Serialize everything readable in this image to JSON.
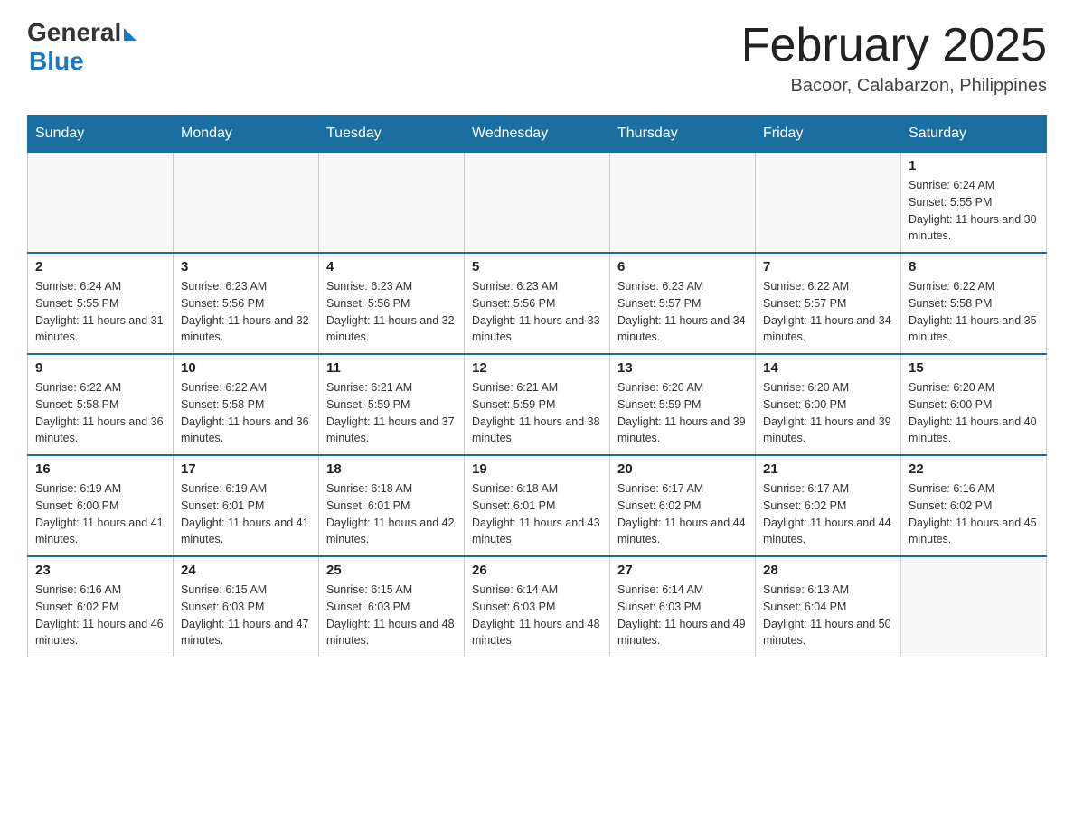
{
  "header": {
    "logo_general": "General",
    "logo_blue": "Blue",
    "month_title": "February 2025",
    "location": "Bacoor, Calabarzon, Philippines"
  },
  "days_of_week": [
    "Sunday",
    "Monday",
    "Tuesday",
    "Wednesday",
    "Thursday",
    "Friday",
    "Saturday"
  ],
  "weeks": [
    [
      {
        "day": "",
        "sunrise": "",
        "sunset": "",
        "daylight": ""
      },
      {
        "day": "",
        "sunrise": "",
        "sunset": "",
        "daylight": ""
      },
      {
        "day": "",
        "sunrise": "",
        "sunset": "",
        "daylight": ""
      },
      {
        "day": "",
        "sunrise": "",
        "sunset": "",
        "daylight": ""
      },
      {
        "day": "",
        "sunrise": "",
        "sunset": "",
        "daylight": ""
      },
      {
        "day": "",
        "sunrise": "",
        "sunset": "",
        "daylight": ""
      },
      {
        "day": "1",
        "sunrise": "Sunrise: 6:24 AM",
        "sunset": "Sunset: 5:55 PM",
        "daylight": "Daylight: 11 hours and 30 minutes."
      }
    ],
    [
      {
        "day": "2",
        "sunrise": "Sunrise: 6:24 AM",
        "sunset": "Sunset: 5:55 PM",
        "daylight": "Daylight: 11 hours and 31 minutes."
      },
      {
        "day": "3",
        "sunrise": "Sunrise: 6:23 AM",
        "sunset": "Sunset: 5:56 PM",
        "daylight": "Daylight: 11 hours and 32 minutes."
      },
      {
        "day": "4",
        "sunrise": "Sunrise: 6:23 AM",
        "sunset": "Sunset: 5:56 PM",
        "daylight": "Daylight: 11 hours and 32 minutes."
      },
      {
        "day": "5",
        "sunrise": "Sunrise: 6:23 AM",
        "sunset": "Sunset: 5:56 PM",
        "daylight": "Daylight: 11 hours and 33 minutes."
      },
      {
        "day": "6",
        "sunrise": "Sunrise: 6:23 AM",
        "sunset": "Sunset: 5:57 PM",
        "daylight": "Daylight: 11 hours and 34 minutes."
      },
      {
        "day": "7",
        "sunrise": "Sunrise: 6:22 AM",
        "sunset": "Sunset: 5:57 PM",
        "daylight": "Daylight: 11 hours and 34 minutes."
      },
      {
        "day": "8",
        "sunrise": "Sunrise: 6:22 AM",
        "sunset": "Sunset: 5:58 PM",
        "daylight": "Daylight: 11 hours and 35 minutes."
      }
    ],
    [
      {
        "day": "9",
        "sunrise": "Sunrise: 6:22 AM",
        "sunset": "Sunset: 5:58 PM",
        "daylight": "Daylight: 11 hours and 36 minutes."
      },
      {
        "day": "10",
        "sunrise": "Sunrise: 6:22 AM",
        "sunset": "Sunset: 5:58 PM",
        "daylight": "Daylight: 11 hours and 36 minutes."
      },
      {
        "day": "11",
        "sunrise": "Sunrise: 6:21 AM",
        "sunset": "Sunset: 5:59 PM",
        "daylight": "Daylight: 11 hours and 37 minutes."
      },
      {
        "day": "12",
        "sunrise": "Sunrise: 6:21 AM",
        "sunset": "Sunset: 5:59 PM",
        "daylight": "Daylight: 11 hours and 38 minutes."
      },
      {
        "day": "13",
        "sunrise": "Sunrise: 6:20 AM",
        "sunset": "Sunset: 5:59 PM",
        "daylight": "Daylight: 11 hours and 39 minutes."
      },
      {
        "day": "14",
        "sunrise": "Sunrise: 6:20 AM",
        "sunset": "Sunset: 6:00 PM",
        "daylight": "Daylight: 11 hours and 39 minutes."
      },
      {
        "day": "15",
        "sunrise": "Sunrise: 6:20 AM",
        "sunset": "Sunset: 6:00 PM",
        "daylight": "Daylight: 11 hours and 40 minutes."
      }
    ],
    [
      {
        "day": "16",
        "sunrise": "Sunrise: 6:19 AM",
        "sunset": "Sunset: 6:00 PM",
        "daylight": "Daylight: 11 hours and 41 minutes."
      },
      {
        "day": "17",
        "sunrise": "Sunrise: 6:19 AM",
        "sunset": "Sunset: 6:01 PM",
        "daylight": "Daylight: 11 hours and 41 minutes."
      },
      {
        "day": "18",
        "sunrise": "Sunrise: 6:18 AM",
        "sunset": "Sunset: 6:01 PM",
        "daylight": "Daylight: 11 hours and 42 minutes."
      },
      {
        "day": "19",
        "sunrise": "Sunrise: 6:18 AM",
        "sunset": "Sunset: 6:01 PM",
        "daylight": "Daylight: 11 hours and 43 minutes."
      },
      {
        "day": "20",
        "sunrise": "Sunrise: 6:17 AM",
        "sunset": "Sunset: 6:02 PM",
        "daylight": "Daylight: 11 hours and 44 minutes."
      },
      {
        "day": "21",
        "sunrise": "Sunrise: 6:17 AM",
        "sunset": "Sunset: 6:02 PM",
        "daylight": "Daylight: 11 hours and 44 minutes."
      },
      {
        "day": "22",
        "sunrise": "Sunrise: 6:16 AM",
        "sunset": "Sunset: 6:02 PM",
        "daylight": "Daylight: 11 hours and 45 minutes."
      }
    ],
    [
      {
        "day": "23",
        "sunrise": "Sunrise: 6:16 AM",
        "sunset": "Sunset: 6:02 PM",
        "daylight": "Daylight: 11 hours and 46 minutes."
      },
      {
        "day": "24",
        "sunrise": "Sunrise: 6:15 AM",
        "sunset": "Sunset: 6:03 PM",
        "daylight": "Daylight: 11 hours and 47 minutes."
      },
      {
        "day": "25",
        "sunrise": "Sunrise: 6:15 AM",
        "sunset": "Sunset: 6:03 PM",
        "daylight": "Daylight: 11 hours and 48 minutes."
      },
      {
        "day": "26",
        "sunrise": "Sunrise: 6:14 AM",
        "sunset": "Sunset: 6:03 PM",
        "daylight": "Daylight: 11 hours and 48 minutes."
      },
      {
        "day": "27",
        "sunrise": "Sunrise: 6:14 AM",
        "sunset": "Sunset: 6:03 PM",
        "daylight": "Daylight: 11 hours and 49 minutes."
      },
      {
        "day": "28",
        "sunrise": "Sunrise: 6:13 AM",
        "sunset": "Sunset: 6:04 PM",
        "daylight": "Daylight: 11 hours and 50 minutes."
      },
      {
        "day": "",
        "sunrise": "",
        "sunset": "",
        "daylight": ""
      }
    ]
  ]
}
